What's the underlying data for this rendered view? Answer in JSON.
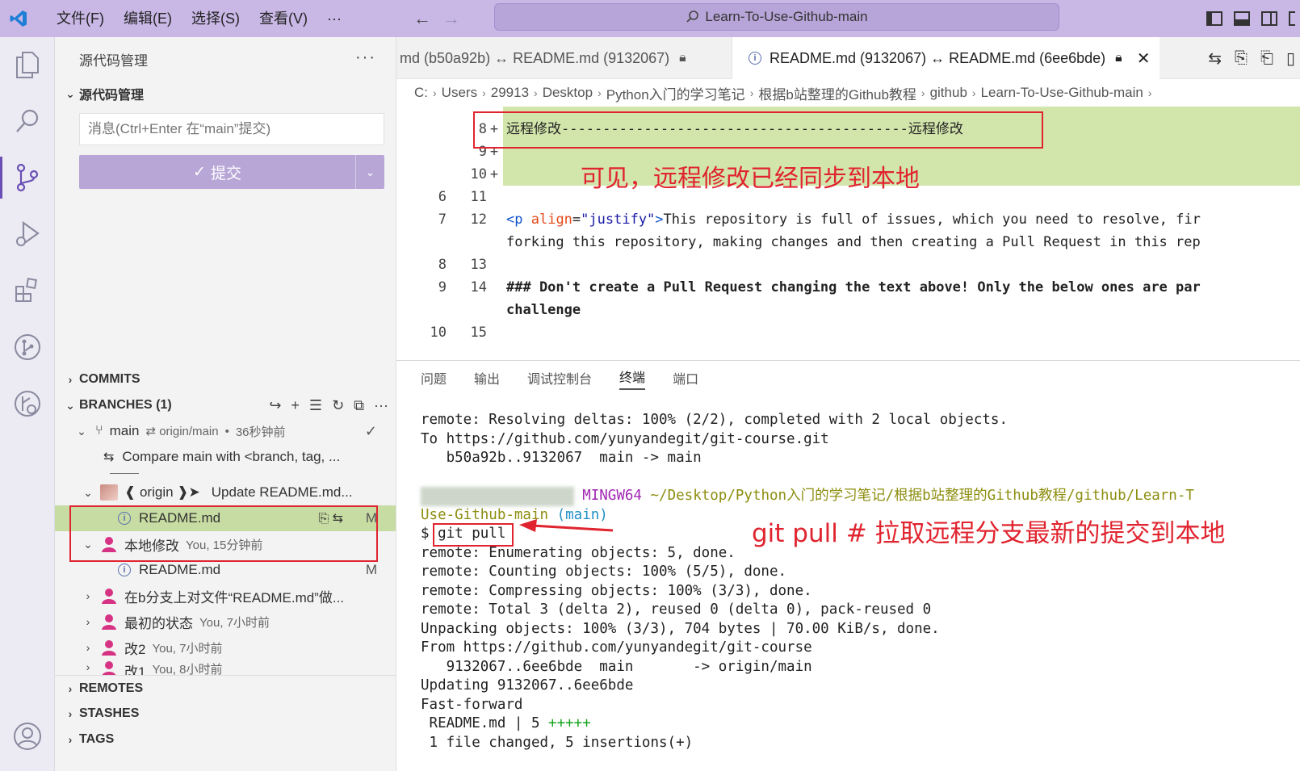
{
  "titlebar": {
    "menu": [
      "文件(F)",
      "编辑(E)",
      "选择(S)",
      "查看(V)",
      "···"
    ],
    "search": "Learn-To-Use-Github-main",
    "colors": {
      "titlebar_bg": "#c9b8e6",
      "accent": "#6a4fb5"
    }
  },
  "sidebar": {
    "title": "源代码管理",
    "more": "···",
    "section_title": "源代码管理",
    "message_placeholder": "消息(Ctrl+Enter 在“main”提交)",
    "commit_label": "提交",
    "commits_title": "COMMITS",
    "branches_title": "BRANCHES (1)",
    "branch": {
      "name": "main",
      "sync": "⇄ origin/main",
      "time": "36秒钟前"
    },
    "compare_text": "Compare main with <branch, tag, ...",
    "origin_row": {
      "label": "❰ origin ❱➤",
      "message": "Update README.md..."
    },
    "origin_file": {
      "name": "README.md",
      "status": "M"
    },
    "local_changes": {
      "label": "本地修改",
      "meta": "You, 15分钟前"
    },
    "local_file": {
      "name": "README.md",
      "status": "M"
    },
    "history": [
      {
        "label": "在b分支上对文件“README.md”做...",
        "meta": ""
      },
      {
        "label": "最初的状态",
        "meta": "You, 7小时前"
      },
      {
        "label": "改2",
        "meta": "You, 7小时前"
      },
      {
        "label": "改1",
        "meta": "You, 8小时前"
      }
    ],
    "remotes_title": "REMOTES",
    "stashes_title": "STASHES",
    "tags_title": "TAGS"
  },
  "editor": {
    "tabs": [
      {
        "label": "md (b50a92b) ↔ README.md (9132067)",
        "active": false
      },
      {
        "label": "README.md (9132067) ↔ README.md (6ee6bde)",
        "active": true
      }
    ],
    "breadcrumb": [
      "C:",
      "Users",
      "29913",
      "Desktop",
      "Python入门的学习笔记",
      "根据b站整理的Github教程",
      "github",
      "Learn-To-Use-Github-main"
    ],
    "lines": [
      {
        "l": "",
        "r": "8",
        "added": true,
        "text": "远程修改------------------------------------------远程修改"
      },
      {
        "l": "",
        "r": "9",
        "added": true,
        "text": ""
      },
      {
        "l": "",
        "r": "10",
        "added": true,
        "text": ""
      },
      {
        "l": "6",
        "r": "11",
        "added": false,
        "text": ""
      },
      {
        "l": "7",
        "r": "12",
        "added": false,
        "text": "This repository is full of issues, which you need to resolve, fir"
      },
      {
        "l": "",
        "r": "",
        "added": false,
        "text": "forking this repository, making changes and then creating a Pull Request in this rep"
      },
      {
        "l": "8",
        "r": "13",
        "added": false,
        "text": ""
      },
      {
        "l": "9",
        "r": "14",
        "added": false,
        "text": "### Don't create a Pull Request changing the text above! Only the below ones are par"
      },
      {
        "l": "",
        "r": "",
        "added": false,
        "text": "challenge"
      },
      {
        "l": "10",
        "r": "15",
        "added": false,
        "text": ""
      }
    ],
    "tag_open": "<p",
    "tag_attr": "align",
    "tag_eq": "=",
    "tag_str": "\"justify\"",
    "tag_close": ">",
    "annotation": "可见，远程修改已经同步到本地"
  },
  "panel": {
    "tabs": [
      "问题",
      "输出",
      "调试控制台",
      "终端",
      "端口"
    ],
    "active_tab": "终端",
    "terminal": [
      "remote: Resolving deltas: 100% (2/2), completed with 2 local objects.",
      "To https://github.com/yunyandegit/git-course.git",
      "   b50a92b..9132067  main -> main",
      "",
      "PROMPT",
      "Use-Github-main (main)",
      "$ git pull",
      "remote: Enumerating objects: 5, done.",
      "remote: Counting objects: 100% (5/5), done.",
      "remote: Compressing objects: 100% (3/3), done.",
      "remote: Total 3 (delta 2), reused 0 (delta 0), pack-reused 0",
      "Unpacking objects: 100% (3/3), 704 bytes | 70.00 KiB/s, done.",
      "From https://github.com/yunyandegit/git-course",
      "   9132067..6ee6bde  main       -> origin/main",
      "Updating 9132067..6ee6bde",
      "Fast-forward",
      " README.md | 5 +++++",
      " 1 file changed, 5 insertions(+)"
    ],
    "prompt_env": "MINGW64",
    "prompt_path": "~/Desktop/Python入门的学习笔记/根据b站整理的Github教程/github/Learn-T",
    "prompt_repo": "Use-Github-main",
    "prompt_branch": "(main)",
    "pull_cmd": "git pull",
    "annotation": "git pull  # 拉取远程分支最新的提交到本地"
  }
}
